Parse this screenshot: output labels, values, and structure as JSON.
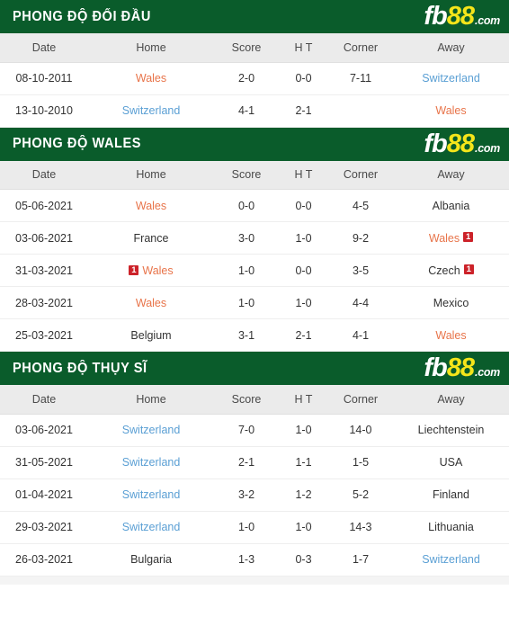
{
  "logo": {
    "part1": "fb",
    "part2": "88",
    "part3": ".com"
  },
  "columns": [
    "Date",
    "Home",
    "Score",
    "H T",
    "Corner",
    "Away"
  ],
  "sections": [
    {
      "title": "PHONG ĐỘ ĐỐI ĐẦU",
      "rows": [
        {
          "date": "08-10-2011",
          "home": "Wales",
          "home_style": "team-wales",
          "home_card_before": "",
          "home_card_after": "",
          "score": "2-0",
          "ht": "0-0",
          "corner": "7-11",
          "away": "Switzerland",
          "away_style": "team-swiss",
          "away_card_after": ""
        },
        {
          "date": "13-10-2010",
          "home": "Switzerland",
          "home_style": "team-swiss",
          "home_card_before": "",
          "home_card_after": "",
          "score": "4-1",
          "ht": "2-1",
          "corner": "",
          "away": "Wales",
          "away_style": "team-wales",
          "away_card_after": ""
        }
      ]
    },
    {
      "title": "PHONG ĐỘ WALES",
      "rows": [
        {
          "date": "05-06-2021",
          "home": "Wales",
          "home_style": "team-wales",
          "home_card_before": "",
          "home_card_after": "",
          "score": "0-0",
          "ht": "0-0",
          "corner": "4-5",
          "away": "Albania",
          "away_style": "team-neutral",
          "away_card_after": ""
        },
        {
          "date": "03-06-2021",
          "home": "France",
          "home_style": "team-neutral",
          "home_card_before": "",
          "home_card_after": "",
          "score": "3-0",
          "ht": "1-0",
          "corner": "9-2",
          "away": "Wales",
          "away_style": "team-wales",
          "away_card_after": "1"
        },
        {
          "date": "31-03-2021",
          "home": "Wales",
          "home_style": "team-wales",
          "home_card_before": "1",
          "home_card_after": "",
          "score": "1-0",
          "ht": "0-0",
          "corner": "3-5",
          "away": "Czech",
          "away_style": "team-neutral",
          "away_card_after": "1"
        },
        {
          "date": "28-03-2021",
          "home": "Wales",
          "home_style": "team-wales",
          "home_card_before": "",
          "home_card_after": "",
          "score": "1-0",
          "ht": "1-0",
          "corner": "4-4",
          "away": "Mexico",
          "away_style": "team-neutral",
          "away_card_after": ""
        },
        {
          "date": "25-03-2021",
          "home": "Belgium",
          "home_style": "team-neutral",
          "home_card_before": "",
          "home_card_after": "",
          "score": "3-1",
          "ht": "2-1",
          "corner": "4-1",
          "away": "Wales",
          "away_style": "team-wales",
          "away_card_after": ""
        }
      ]
    },
    {
      "title": "PHONG ĐỘ THỤY SĨ",
      "rows": [
        {
          "date": "03-06-2021",
          "home": "Switzerland",
          "home_style": "team-swiss",
          "home_card_before": "",
          "home_card_after": "",
          "score": "7-0",
          "ht": "1-0",
          "corner": "14-0",
          "away": "Liechtenstein",
          "away_style": "team-neutral",
          "away_card_after": ""
        },
        {
          "date": "31-05-2021",
          "home": "Switzerland",
          "home_style": "team-swiss",
          "home_card_before": "",
          "home_card_after": "",
          "score": "2-1",
          "ht": "1-1",
          "corner": "1-5",
          "away": "USA",
          "away_style": "team-neutral",
          "away_card_after": ""
        },
        {
          "date": "01-04-2021",
          "home": "Switzerland",
          "home_style": "team-swiss",
          "home_card_before": "",
          "home_card_after": "",
          "score": "3-2",
          "ht": "1-2",
          "corner": "5-2",
          "away": "Finland",
          "away_style": "team-neutral",
          "away_card_after": ""
        },
        {
          "date": "29-03-2021",
          "home": "Switzerland",
          "home_style": "team-swiss",
          "home_card_before": "",
          "home_card_after": "",
          "score": "1-0",
          "ht": "1-0",
          "corner": "14-3",
          "away": "Lithuania",
          "away_style": "team-neutral",
          "away_card_after": ""
        },
        {
          "date": "26-03-2021",
          "home": "Bulgaria",
          "home_style": "team-neutral",
          "home_card_before": "",
          "home_card_after": "",
          "score": "1-3",
          "ht": "0-3",
          "corner": "1-7",
          "away": "Switzerland",
          "away_style": "team-swiss",
          "away_card_after": ""
        }
      ]
    }
  ],
  "colors": {
    "banner_green": "#0a5c2b",
    "logo_yellow": "#f5e51a",
    "score_red": "#c0392b",
    "wales_orange": "#e8744a",
    "swiss_blue": "#5a9fd4",
    "redcard_red": "#cc2229",
    "header_gray": "#ebebeb"
  }
}
